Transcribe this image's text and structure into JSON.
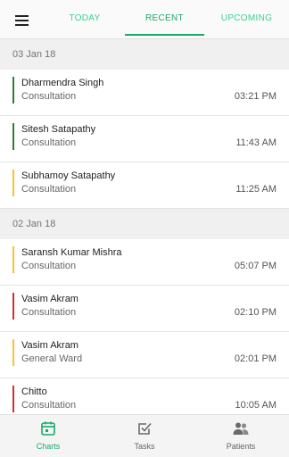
{
  "header": {
    "tabs": [
      {
        "label": "TODAY"
      },
      {
        "label": "RECENT"
      },
      {
        "label": "UPCOMING"
      }
    ],
    "active_tab": "RECENT"
  },
  "groups": [
    {
      "date": "03 Jan 18",
      "items": [
        {
          "name": "Dharmendra Singh",
          "type": "Consultation",
          "time": "03:21 PM",
          "indicator_color": "#2e7d32"
        },
        {
          "name": "Sitesh Satapathy",
          "type": "Consultation",
          "time": "11:43 AM",
          "indicator_color": "#2e7d32"
        },
        {
          "name": "Subhamoy Satapathy",
          "type": "Consultation",
          "time": "11:25 AM",
          "indicator_color": "#fbc02d"
        }
      ]
    },
    {
      "date": "02 Jan 18",
      "items": [
        {
          "name": "Saransh Kumar Mishra",
          "type": "Consultation",
          "time": "05:07 PM",
          "indicator_color": "#fbc02d"
        },
        {
          "name": "Vasim Akram",
          "type": "Consultation",
          "time": "02:10 PM",
          "indicator_color": "#d32f2f"
        },
        {
          "name": "Vasim Akram",
          "type": "General Ward",
          "time": "02:01 PM",
          "indicator_color": "#fbc02d"
        },
        {
          "name": "Chitto",
          "type": "Consultation",
          "time": "10:05 AM",
          "indicator_color": "#d32f2f"
        }
      ]
    }
  ],
  "bottom_nav": [
    {
      "label": "Charts",
      "icon": "calendar-icon"
    },
    {
      "label": "Tasks",
      "icon": "checkbox-icon"
    },
    {
      "label": "Patients",
      "icon": "people-icon"
    }
  ],
  "active_nav": "Charts",
  "colors": {
    "accent": "#1aa86c",
    "tab_text": "#3ecf94",
    "status_green": "#2e7d32",
    "status_yellow": "#fbc02d",
    "status_red": "#d32f2f"
  }
}
